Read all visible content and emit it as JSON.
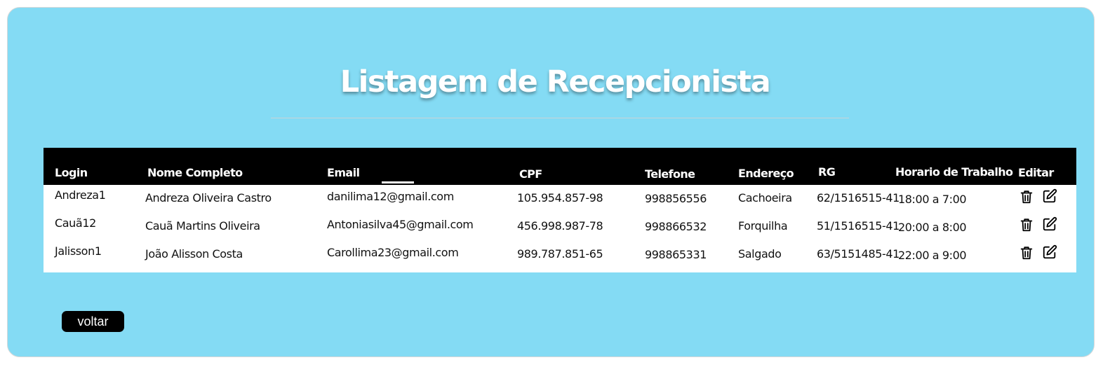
{
  "page": {
    "title": "Listagem de Recepcionista"
  },
  "table": {
    "headers": {
      "login": "Login",
      "name": "Nome Completo",
      "email": "Email",
      "cpf": "CPF",
      "phone": "Telefone",
      "address": "Endereço",
      "rg": "RG",
      "schedule": "Horario de Trabalho",
      "edit": "Editar"
    },
    "rows": [
      {
        "login": "Andreza1",
        "name": "Andreza Oliveira Castro",
        "email": "danilima12@gmail.com",
        "cpf": "105.954.857-98",
        "phone": "998856556",
        "address": "Cachoeira",
        "rg": "62/1516515-41",
        "schedule": "18:00 a 7:00"
      },
      {
        "login": "Cauã12",
        "name": "Cauã Martins Oliveira",
        "email": "Antoniasilva45@gmail.com",
        "cpf": "456.998.987-78",
        "phone": "998866532",
        "address": "Forquilha",
        "rg": "51/1516515-41",
        "schedule": "20:00 a 8:00"
      },
      {
        "login": "Jalisson1",
        "name": "João Alisson Costa",
        "email": "Carollima23@gmail.com",
        "cpf": "989.787.851-65",
        "phone": "998865331",
        "address": "Salgado",
        "rg": "63/5151485-41",
        "schedule": "22:00 a 9:00"
      }
    ],
    "row_actions": {
      "delete_icon": "trash-icon",
      "edit_icon": "edit-icon"
    }
  },
  "footer": {
    "back_label": "voltar"
  },
  "colors": {
    "background": "#84dbf4",
    "header_background": "#000000",
    "button_background": "#000000",
    "title_color": "#ffffff"
  }
}
